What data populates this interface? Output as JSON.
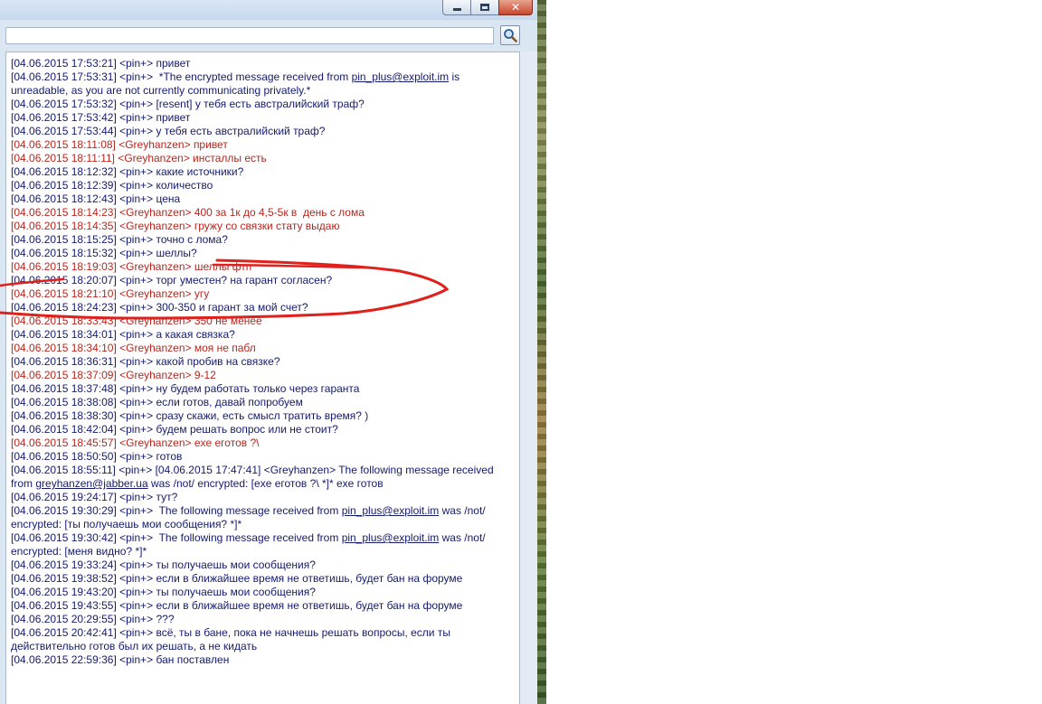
{
  "window": {
    "titlebar_buttons": [
      "minimize-icon",
      "maximize-icon",
      "close-icon"
    ],
    "close_glyph": "✕"
  },
  "search": {
    "value": "",
    "placeholder": "",
    "icon": "magnifier-search-icon"
  },
  "messages": [
    {
      "who": "me",
      "text": "[04.06.2015 17:53:21] <pin+> привет"
    },
    {
      "who": "me",
      "pre": "[04.06.2015 17:53:31] <pin+>  *The encrypted message received from ",
      "link": "pin_plus@exploit.im",
      "post": " is unreadable, as you are not currently communicating privately.*"
    },
    {
      "who": "me",
      "text": "[04.06.2015 17:53:32] <pin+> [resent] у тебя есть австралийский траф?"
    },
    {
      "who": "me",
      "text": "[04.06.2015 17:53:42] <pin+> привет"
    },
    {
      "who": "me",
      "text": "[04.06.2015 17:53:44] <pin+> у тебя есть австралийский траф?"
    },
    {
      "who": "them",
      "text": "[04.06.2015 18:11:08] <Greyhanzen> привет"
    },
    {
      "who": "them",
      "text": "[04.06.2015 18:11:11] <Greyhanzen> инсталлы есть"
    },
    {
      "who": "me",
      "text": "[04.06.2015 18:12:32] <pin+> какие источники?"
    },
    {
      "who": "me",
      "text": "[04.06.2015 18:12:39] <pin+> количество"
    },
    {
      "who": "me",
      "text": "[04.06.2015 18:12:43] <pin+> цена"
    },
    {
      "who": "them",
      "text": "[04.06.2015 18:14:23] <Greyhanzen> 400 за 1к до 4,5-5к в  день с лома"
    },
    {
      "who": "them",
      "text": "[04.06.2015 18:14:35] <Greyhanzen> гружу со связки стату выдаю"
    },
    {
      "who": "me",
      "text": "[04.06.2015 18:15:25] <pin+> точно с лома?"
    },
    {
      "who": "me",
      "text": "[04.06.2015 18:15:32] <pin+> шеллы?"
    },
    {
      "who": "them",
      "text": "[04.06.2015 18:19:03] <Greyhanzen> шеллы фтп"
    },
    {
      "who": "me",
      "text": "[04.06.2015 18:20:07] <pin+> торг уместен? на гарант согласен?"
    },
    {
      "who": "them",
      "text": "[04.06.2015 18:21:10] <Greyhanzen> угу"
    },
    {
      "who": "me",
      "text": "[04.06.2015 18:24:23] <pin+> 300-350 и гарант за мой счет?"
    },
    {
      "who": "them",
      "text": "[04.06.2015 18:33:43] <Greyhanzen> 350 не менее"
    },
    {
      "who": "me",
      "text": "[04.06.2015 18:34:01] <pin+> а какая связка?"
    },
    {
      "who": "them",
      "text": "[04.06.2015 18:34:10] <Greyhanzen> моя не пабл"
    },
    {
      "who": "me",
      "text": "[04.06.2015 18:36:31] <pin+> какой пробив на связке?"
    },
    {
      "who": "them",
      "text": "[04.06.2015 18:37:09] <Greyhanzen> 9-12"
    },
    {
      "who": "me",
      "text": "[04.06.2015 18:37:48] <pin+> ну будем работать только через гаранта"
    },
    {
      "who": "me",
      "text": "[04.06.2015 18:38:08] <pin+> если готов, давай попробуем"
    },
    {
      "who": "me",
      "text": "[04.06.2015 18:38:30] <pin+> сразу скажи, есть смысл тратить время? )"
    },
    {
      "who": "me",
      "text": "[04.06.2015 18:42:04] <pin+> будем решать вопрос или не стоит?"
    },
    {
      "who": "them",
      "text": "[04.06.2015 18:45:57] <Greyhanzen> exe еготов ?\\"
    },
    {
      "who": "me",
      "text": "[04.06.2015 18:50:50] <pin+> готов"
    },
    {
      "who": "me",
      "pre": "[04.06.2015 18:55:11] <pin+> [04.06.2015 17:47:41] <Greyhanzen> The following message received from ",
      "link": "greyhanzen@jabber.ua",
      "post": " was /not/ encrypted: [exe еготов ?\\ *]* exe готов"
    },
    {
      "who": "me",
      "text": "[04.06.2015 19:24:17] <pin+> тут?"
    },
    {
      "who": "me",
      "pre": "[04.06.2015 19:30:29] <pin+>  The following message received from ",
      "link": "pin_plus@exploit.im",
      "post": " was /not/ encrypted: [ты получаешь мои сообщения? *]*"
    },
    {
      "who": "me",
      "pre": "[04.06.2015 19:30:42] <pin+>  The following message received from ",
      "link": "pin_plus@exploit.im",
      "post": " was /not/ encrypted: [меня видно? *]*"
    },
    {
      "who": "me",
      "text": "[04.06.2015 19:33:24] <pin+> ты получаешь мои сообщения?"
    },
    {
      "who": "me",
      "text": "[04.06.2015 19:38:52] <pin+> если в ближайшее время не ответишь, будет бан на форуме"
    },
    {
      "who": "me",
      "text": "[04.06.2015 19:43:20] <pin+> ты получаешь мои сообщения?"
    },
    {
      "who": "me",
      "text": "[04.06.2015 19:43:55] <pin+> если в ближайшее время не ответишь, будет бан на форуме"
    },
    {
      "who": "me",
      "text": "[04.06.2015 20:29:55] <pin+> ???"
    },
    {
      "who": "me",
      "text": "[04.06.2015 20:42:41] <pin+> всё, ты в бане, пока не начнешь решать вопросы, если ты действительно готов был их решать, а не кидать"
    },
    {
      "who": "me",
      "text": "[04.06.2015 22:59:36] <pin+> бан поставлен"
    }
  ],
  "colors": {
    "self_text": "#141a6e",
    "other_text": "#b8251d",
    "annotation": "#e0201c",
    "window_frame": "#dbe6f3"
  },
  "annotation": {
    "kind": "hand-drawn red ellipse",
    "highlights_messages": [
      "18:20:07",
      "18:21:10",
      "18:24:23"
    ]
  }
}
